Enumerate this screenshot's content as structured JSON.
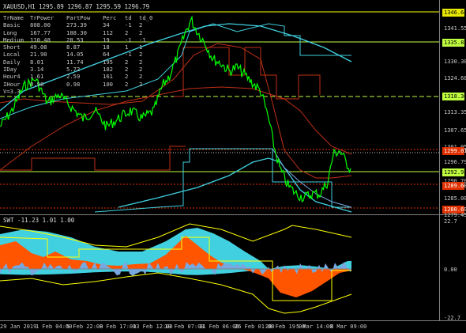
{
  "chart": {
    "title": "XAUUSD,H1 1295.89 1296.87 1295.59 1296.79",
    "oscillator_title": "SWT -11.23 1.01 1.00"
  },
  "stats_table": {
    "headers": [
      "TrName",
      "TrPower",
      "PartPow",
      "Perc",
      "td",
      "td_0"
    ],
    "rows": [
      [
        "Basic",
        "808.00",
        "273.39",
        "34",
        "-1",
        "2"
      ],
      [
        "Long",
        "167.77",
        "188.30",
        "112",
        "2",
        "2"
      ],
      [
        "Medium",
        "110.48",
        "28.53",
        "19",
        "-1",
        "-1"
      ],
      [
        "Short",
        "49.08",
        "8.87",
        "18",
        "1",
        "1"
      ],
      [
        "Local",
        "21.90",
        "14.05",
        "64",
        "-1",
        "2"
      ],
      [
        "Daily",
        "8.01",
        "11.74",
        "195",
        "2",
        "2"
      ],
      [
        "IDay",
        "3.14",
        "5.72",
        "182",
        "2",
        "2"
      ],
      [
        "Hour4",
        "1.61",
        "2.59",
        "161",
        "2",
        "2"
      ],
      [
        "IHour",
        "0.98",
        "0.98",
        "100",
        "2",
        "2"
      ],
      [
        "V=3.3",
        "",
        "",
        "",
        "",
        ""
      ]
    ]
  },
  "price_axis": {
    "labels": [
      {
        "text": "1346.64",
        "bg": "#e8e800",
        "fg": "#000000"
      },
      {
        "text": "1341.55",
        "bg": "",
        "fg": "#c8c8c8"
      },
      {
        "text": "1335.82",
        "bg": "#c0ff40",
        "fg": "#000000"
      },
      {
        "text": "1330.30",
        "bg": "",
        "fg": "#c8c8c8"
      },
      {
        "text": "1324.60",
        "bg": "",
        "fg": "#c8c8c8"
      },
      {
        "text": "1318.30",
        "bg": "#c0ff40",
        "fg": "#000000"
      },
      {
        "text": "1313.35",
        "bg": "",
        "fg": "#c8c8c8"
      },
      {
        "text": "1307.65",
        "bg": "",
        "fg": "#c8c8c8"
      },
      {
        "text": "1301.95",
        "bg": "",
        "fg": "#c8c8c8"
      },
      {
        "text": "1299.01",
        "bg": "#e03000",
        "fg": "#ffffff"
      },
      {
        "text": "1296.79",
        "bg": "",
        "fg": "#c8c8c8"
      },
      {
        "text": "1292.95",
        "bg": "#c0ff40",
        "fg": "#000000"
      },
      {
        "text": "1290.70",
        "bg": "",
        "fg": "#c8c8c8"
      },
      {
        "text": "1289.60",
        "bg": "#e03000",
        "fg": "#ffffff"
      },
      {
        "text": "1285.00",
        "bg": "",
        "fg": "#c8c8c8"
      },
      {
        "text": "1280.69",
        "bg": "#e03000",
        "fg": "#ffffff"
      },
      {
        "text": "1279.45",
        "bg": "",
        "fg": "#c8c8c8"
      }
    ]
  },
  "osc_axis": {
    "labels": [
      "22.7",
      "0.00",
      "-22.7"
    ]
  },
  "time_axis": {
    "labels": [
      "29 Jan 2019",
      "1 Feb 04:00",
      "5 Feb 22:00",
      "8 Feb 17:00",
      "13 Feb 12:00",
      "18 Feb 07:00",
      "21 Feb 06:00",
      "26 Feb 01:00",
      "28 Feb 19:00",
      "5 Mar 14:00",
      "8 Mar 09:00"
    ]
  },
  "colors": {
    "price": "#00ff00",
    "cyan": "#40d0e0",
    "red": "#c03018",
    "yellow": "#ffff00",
    "orange": "#ff5500",
    "lightblue": "#78a8e0"
  }
}
